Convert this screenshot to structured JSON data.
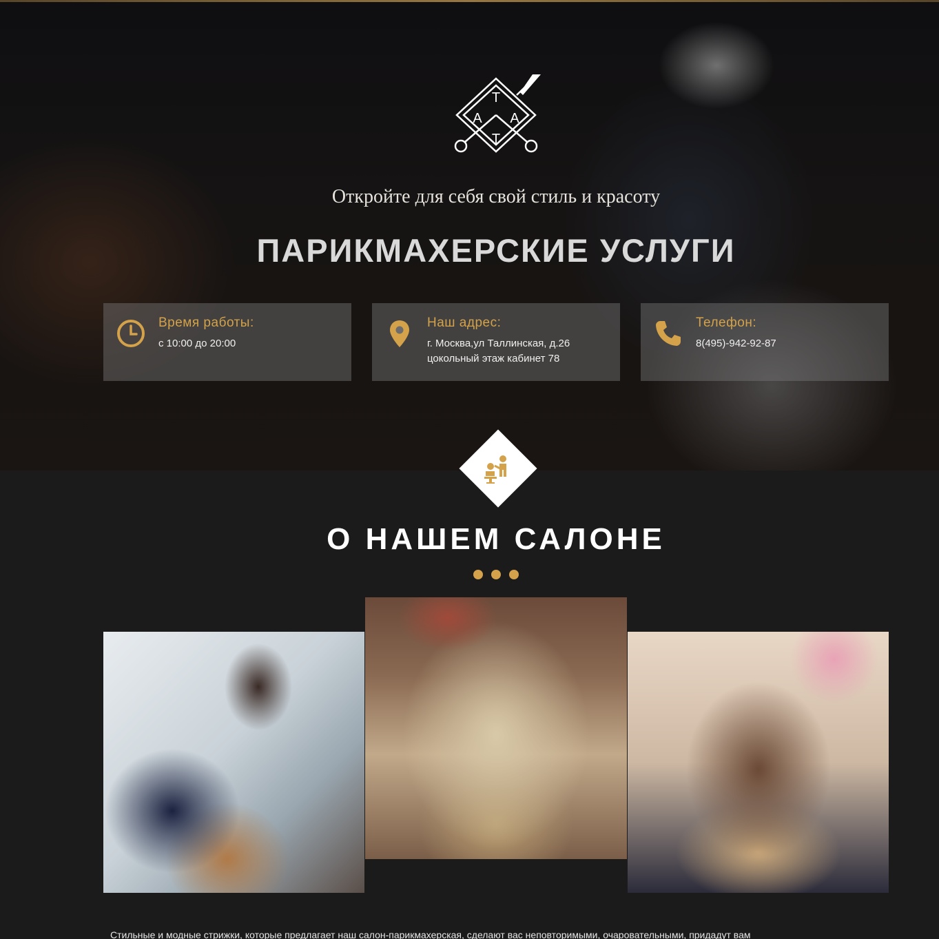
{
  "hero": {
    "tagline": "Откройте для себя свой стиль и красоту",
    "title": "ПАРИКМАХЕРСКИЕ УСЛУГИ",
    "logo_letters": [
      "Т",
      "А",
      "А",
      "Т"
    ]
  },
  "info": [
    {
      "icon": "clock-icon",
      "title": "Время работы:",
      "lines": [
        "с 10:00 до 20:00",
        ""
      ]
    },
    {
      "icon": "map-pin-icon",
      "title": "Наш адрес:",
      "lines": [
        "г. Москва,ул Таллинская, д.26",
        "цокольный этаж кабинет 78"
      ]
    },
    {
      "icon": "phone-icon",
      "title": "Телефон:",
      "lines": [
        "8(495)-942-92-87",
        ""
      ]
    }
  ],
  "about": {
    "icon": "hairdresser-icon",
    "title": "О НАШЕМ САЛОНЕ",
    "text": "Стильные и модные стрижки, которые предлагает наш салон-парикмахерская, сделают вас неповторимыми, очаровательными, придадут вам"
  },
  "colors": {
    "accent": "#d3a24a",
    "background": "#1b1b1c",
    "info_box": "rgba(120,120,120,0.45)"
  }
}
